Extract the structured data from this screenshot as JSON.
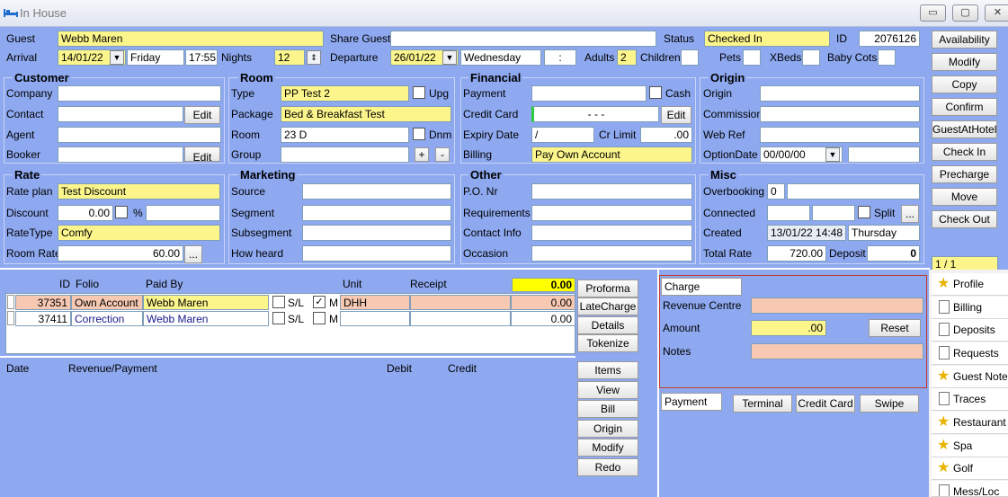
{
  "window": {
    "title": "In House",
    "min": "▭",
    "max": "▢",
    "close": "✕"
  },
  "header": {
    "guest_label": "Guest",
    "guest_value": "Webb Maren",
    "share_label": "Share Guest",
    "share_value": "",
    "status_label": "Status",
    "status_value": "Checked In",
    "id_label": "ID",
    "id_value": "2076126",
    "arrival_label": "Arrival",
    "arrival_date": "14/01/22",
    "arrival_day": "Friday",
    "arrival_time": "17:55",
    "nights_label": "Nights",
    "nights_value": "12",
    "departure_label": "Departure",
    "departure_date": "26/01/22",
    "departure_day": "Wednesday",
    "departure_time": ":",
    "adults_label": "Adults",
    "adults_value": "2",
    "children_label": "Children",
    "pets_label": "Pets",
    "xbeds_label": "XBeds",
    "babycots_label": "Baby Cots"
  },
  "customer": {
    "title": "Customer",
    "company": "Company",
    "contact": "Contact",
    "agent": "Agent",
    "booker": "Booker",
    "edit": "Edit"
  },
  "room": {
    "title": "Room",
    "type_label": "Type",
    "type_value": "PP Test 2",
    "upg": "Upg",
    "package_label": "Package",
    "package_value": "Bed & Breakfast Test",
    "room_label": "Room",
    "room_value": "23 D",
    "dnm": "Dnm",
    "group_label": "Group",
    "plus": "+",
    "minus": "-"
  },
  "financial": {
    "title": "Financial",
    "payment": "Payment",
    "cash": "Cash",
    "credit_card": "Credit Card",
    "cc_value": "- - -",
    "edit": "Edit",
    "expiry": "Expiry Date",
    "expiry_value": "/",
    "cr_limit": "Cr Limit",
    "cr_limit_value": ".00",
    "billing": "Billing",
    "billing_value": "Pay Own Account"
  },
  "origin": {
    "title": "Origin",
    "origin": "Origin",
    "commission": "Commission",
    "web_ref": "Web Ref",
    "option_date": "OptionDate",
    "option_value": "00/00/00"
  },
  "rate": {
    "title": "Rate",
    "plan_label": "Rate plan",
    "plan_value": "Test Discount",
    "discount_label": "Discount",
    "discount_value": "0.00",
    "pct": "%",
    "ratetype_label": "RateType",
    "ratetype_value": "Comfy",
    "roomrate_label": "Room Rate",
    "roomrate_value": "60.00",
    "dots": "..."
  },
  "marketing": {
    "title": "Marketing",
    "source": "Source",
    "segment": "Segment",
    "subsegment": "Subsegment",
    "how_heard": "How heard"
  },
  "other": {
    "title": "Other",
    "po": "P.O. Nr",
    "requirements": "Requirements",
    "contact_info": "Contact Info",
    "occasion": "Occasion"
  },
  "misc": {
    "title": "Misc",
    "overbooking": "Overbooking",
    "overbooking_value": "0",
    "connected": "Connected",
    "split": "Split",
    "dots": "...",
    "created": "Created",
    "created_value": "13/01/22 14:48",
    "created_day": "Thursday",
    "total_rate": "Total Rate",
    "total_rate_value": "720.00",
    "deposit": "Deposit",
    "deposit_value": "0"
  },
  "side_buttons": [
    "Availability",
    "Modify",
    "Copy",
    "Confirm",
    "GuestAtHotel",
    "Check In",
    "Precharge",
    "Move",
    "Check Out"
  ],
  "pager": "1 / 1",
  "folio": {
    "headers": {
      "id": "ID",
      "folio": "Folio",
      "paid_by": "Paid By",
      "unit": "Unit",
      "receipt": "Receipt"
    },
    "total": "0.00",
    "rows": [
      {
        "id": "37351",
        "folio": "Own Account",
        "paid_by": "Webb Maren",
        "sl": "S/L",
        "m": "M",
        "unit": "DHH",
        "amount": "0.00"
      },
      {
        "id": "37411",
        "folio": "Correction",
        "paid_by": "Webb Maren",
        "sl": "S/L",
        "m": "M",
        "unit": "",
        "amount": "0.00"
      }
    ],
    "buttons": [
      "Proforma",
      "LateCharge",
      "Details",
      "Tokenize"
    ]
  },
  "transactions": {
    "headers": {
      "date": "Date",
      "revenue": "Revenue/Payment",
      "debit": "Debit",
      "credit": "Credit"
    },
    "buttons": [
      "Items",
      "View",
      "Bill",
      "Origin",
      "Modify",
      "Redo"
    ]
  },
  "charge": {
    "tab": "Charge",
    "revenue_centre": "Revenue Centre",
    "amount": "Amount",
    "amount_value": ".00",
    "reset": "Reset",
    "notes": "Notes"
  },
  "payment": {
    "tab": "Payment",
    "terminal": "Terminal",
    "credit_card": "Credit Card",
    "swipe": "Swipe"
  },
  "tabs": [
    {
      "label": "Profile",
      "icon": "star"
    },
    {
      "label": "Billing",
      "icon": "page"
    },
    {
      "label": "Deposits",
      "icon": "page"
    },
    {
      "label": "Requests",
      "icon": "page"
    },
    {
      "label": "Guest Notes",
      "icon": "star"
    },
    {
      "label": "Traces",
      "icon": "page"
    },
    {
      "label": "Restaurant",
      "icon": "star"
    },
    {
      "label": "Spa",
      "icon": "star"
    },
    {
      "label": "Golf",
      "icon": "star"
    },
    {
      "label": "Mess/Loc",
      "icon": "page"
    }
  ]
}
